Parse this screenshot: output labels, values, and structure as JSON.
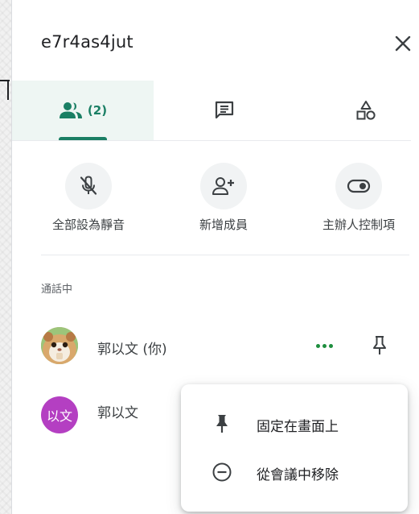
{
  "meeting": {
    "code": "e7r4as4jut"
  },
  "tabs": {
    "people_count": "(2)"
  },
  "actions": [
    {
      "label": "全部設為靜音",
      "icon": "mic-off-icon"
    },
    {
      "label": "新增成員",
      "icon": "person-add-icon"
    },
    {
      "label": "主辦人控制項",
      "icon": "toggle-icon"
    }
  ],
  "section": {
    "in_call_label": "通話中"
  },
  "participants": [
    {
      "name": "郭以文 (你)",
      "avatar": "photo"
    },
    {
      "name": "郭以文",
      "avatar_initials": "以文",
      "avatar_color": "#b43fc2"
    }
  ],
  "context_menu": {
    "items": [
      {
        "label": "固定在畫面上",
        "icon": "pin-icon"
      },
      {
        "label": "從會議中移除",
        "icon": "remove-circle-icon"
      }
    ]
  },
  "colors": {
    "accent": "#1a7f64",
    "more_dots": "#1e8e3e"
  }
}
